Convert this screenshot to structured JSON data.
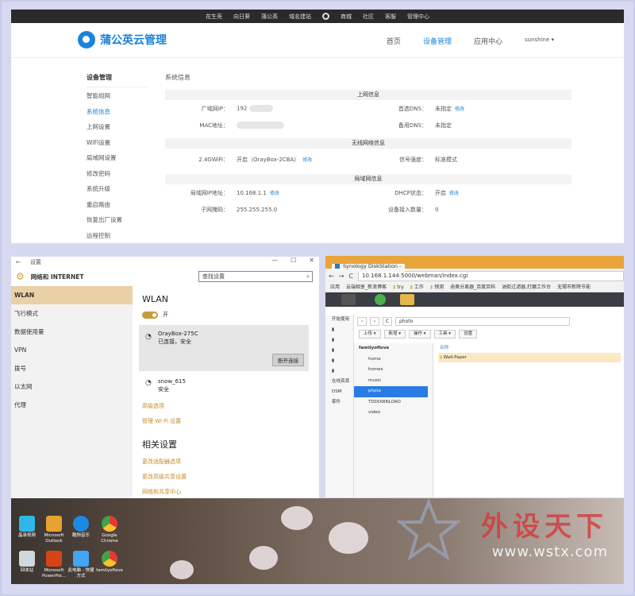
{
  "router": {
    "topbar": [
      "花生壳",
      "向日葵",
      "蒲公英",
      "域名建站",
      "商城",
      "社区",
      "客服",
      "管理中心"
    ],
    "logo": "蒲公英云管理",
    "nav": {
      "home": "首页",
      "device": "设备管理",
      "apps": "应用中心",
      "user": "sunshine ▾"
    },
    "sidebar_title": "设备管理",
    "sidebar": [
      "智能组网",
      "系统信息",
      "上网设置",
      "WiFi设置",
      "局域网设置",
      "修改密码",
      "系统升级",
      "重启路由",
      "恢复出厂设置",
      "远程控制"
    ],
    "content_title": "系统信息",
    "sec_internet": "上网信息",
    "wan_ip_label": "广域网IP：",
    "wan_ip_value": "192",
    "dns1_label": "首选DNS：",
    "dns1_value": "未指定",
    "mac_label": "MAC地址：",
    "dns2_label": "备用DNS：",
    "dns2_value": "未指定",
    "sec_wireless": "无线网络信息",
    "wifi_label": "2.4GWiFi：",
    "wifi_value": "开启（OrayBox-2CBA）",
    "signal_label": "信号强度：",
    "signal_value": "标准模式",
    "sec_lan": "局域网信息",
    "lan_ip_label": "局域网IP地址：",
    "lan_ip_value": "10.168.1.1",
    "dhcp_label": "DHCP状态：",
    "dhcp_value": "开启",
    "mask_label": "子网掩码：",
    "mask_value": "255.255.255.0",
    "devices_label": "设备接入数量：",
    "devices_value": "0",
    "edit": "修改"
  },
  "settings": {
    "window_title": "设置",
    "header": "网络和 INTERNET",
    "search_placeholder": "查找设置",
    "left": [
      "WLAN",
      "飞行模式",
      "数据使用量",
      "VPN",
      "拨号",
      "以太网",
      "代理"
    ],
    "heading": "WLAN",
    "toggle_label": "开",
    "net1_name": "OrayBox-275C",
    "net1_status": "已连接，安全",
    "disconnect": "断开连接",
    "net2_name": "snow_615",
    "net2_status": "安全",
    "advanced": "高级选项",
    "manage": "管理 Wi-Fi 设置",
    "related": "相关设置",
    "adapter": "更改适配器选项",
    "sharing": "更改高级共享设置",
    "netcenter": "网络和共享中心"
  },
  "browser": {
    "tab_title": "Synology DiskStation -",
    "url": "10.168.1.144:5000/webman/index.cgi",
    "bookmarks": [
      "应用",
      "云端相享_新浪博客",
      "try",
      "工作",
      "预测",
      "迪奥分离器_百度百科",
      "油街过滤器,打磨工作台",
      "无锡市新降节能"
    ],
    "path": "photo",
    "buttons": [
      "上传 ▾",
      "新增 ▾",
      "操作 ▾",
      "工具 ▾",
      "设置"
    ],
    "left_panel": [
      "开始使用",
      "",
      "",
      "",
      "",
      "",
      "在线资源",
      "DSM",
      "套件"
    ],
    "tree_root": "familyoflove",
    "tree": [
      "home",
      "homes",
      "music",
      "photo",
      "TDDOWNLOAD",
      "video"
    ],
    "col_name": "名称",
    "files": [
      "Wall-Paper"
    ]
  },
  "desktop": {
    "icons": [
      "晶录视频",
      "Microsoft Outlook",
      "酷狗音乐",
      "Google Chrome",
      "回收站",
      "Microsoft PowerPoi...",
      "此电脑 - 快捷方式",
      "familyoflove"
    ],
    "watermark": "外设天下",
    "watermark_url": "www.wstx.com"
  }
}
